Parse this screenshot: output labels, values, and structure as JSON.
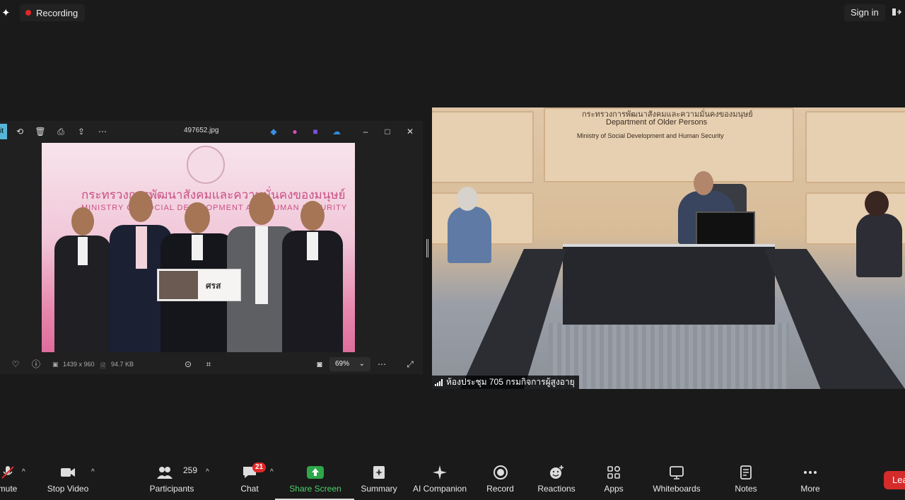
{
  "topbar": {
    "recording_label": "Recording",
    "signin_label": "Sign in"
  },
  "viewer": {
    "filename": "497652.jpg",
    "edit_label": "it",
    "dimensions": "1439 x 960",
    "filesize": "94.7 KB",
    "zoom": "69%",
    "photo_title_th": "กระทรวงการพัฒนาสังคมและความมั่นคงของมนุษย์",
    "photo_title_en": "MINISTRY OF SOCIAL DEVELOPMENT AND HUMAN SECURITY",
    "sign_text": "ศรส"
  },
  "room": {
    "sign_th": "กระทรวงการพัฒนาสังคมและความมั่นคงของมนุษย์",
    "sign_en_dept": "Department of Older Persons",
    "sign_en_ministry": "Ministry of Social Development and Human Security",
    "participant_name": "ห้องประชุม 705 กรมกิจการผู้สูงอายุ"
  },
  "toolbar": {
    "mute_label": "mute",
    "stop_video_label": "Stop Video",
    "participants_label": "Participants",
    "participants_count": "259",
    "chat_label": "Chat",
    "chat_badge": "21",
    "share_label": "Share Screen",
    "summary_label": "Summary",
    "ai_label": "AI Companion",
    "record_label": "Record",
    "reactions_label": "Reactions",
    "apps_label": "Apps",
    "whiteboards_label": "Whiteboards",
    "notes_label": "Notes",
    "more_label": "More",
    "leave_label": "Lea"
  },
  "colors": {
    "recording_dot": "#e02828",
    "share_green": "#2ea64a",
    "leave_red": "#d52b2b",
    "background": "#1a1a1a"
  }
}
